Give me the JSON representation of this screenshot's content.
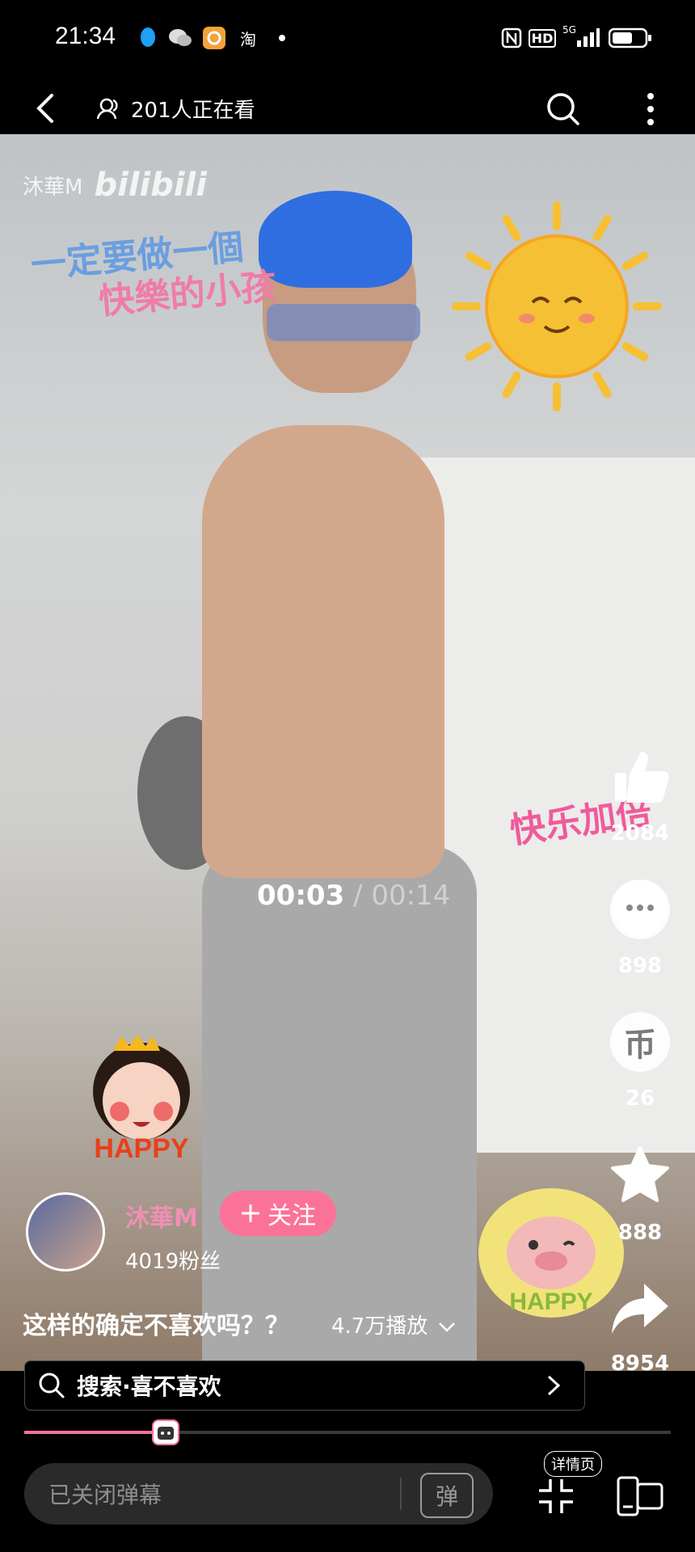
{
  "status_bar": {
    "time": "21:34",
    "icons": [
      "qq-icon",
      "wechat-icon",
      "app-icon",
      "taobao-icon",
      "dot-icon",
      "nfc-icon",
      "hd-icon",
      "5g-signal-icon",
      "battery-icon"
    ],
    "taobao_label": "淘",
    "hd_label": "HD",
    "net_label": "5G"
  },
  "nav": {
    "viewers": "201人正在看"
  },
  "video": {
    "watermark_user": "沐華M",
    "watermark_logo": "bilibili",
    "sticker_top_line1": "一定要做一個",
    "sticker_top_line2": "快樂的小孩",
    "sticker_joy": "快乐加倍",
    "sticker_happy": "HAPPY",
    "time_current": "00:03",
    "time_separator": " / ",
    "time_total": "00:14"
  },
  "rail": {
    "like_count": "2084",
    "comment_count": "898",
    "coin_count": "26",
    "coin_glyph": "币",
    "favorite_count": "888",
    "share_count": "8954"
  },
  "author": {
    "name": "沐華M",
    "follow_label": "关注",
    "fans": "4019粉丝"
  },
  "info": {
    "title": "这样的确定不喜欢吗？？",
    "plays": "4.7万播放"
  },
  "search": {
    "text": "搜索·喜不喜欢"
  },
  "progress": {
    "played_fraction": 0.214
  },
  "bottom": {
    "danmaku_placeholder": "已关闭弹幕",
    "danmaku_toggle": "弹",
    "detail_label": "详情页"
  },
  "colors": {
    "accent": "#fb7299",
    "author_name": "#f08fb5"
  }
}
